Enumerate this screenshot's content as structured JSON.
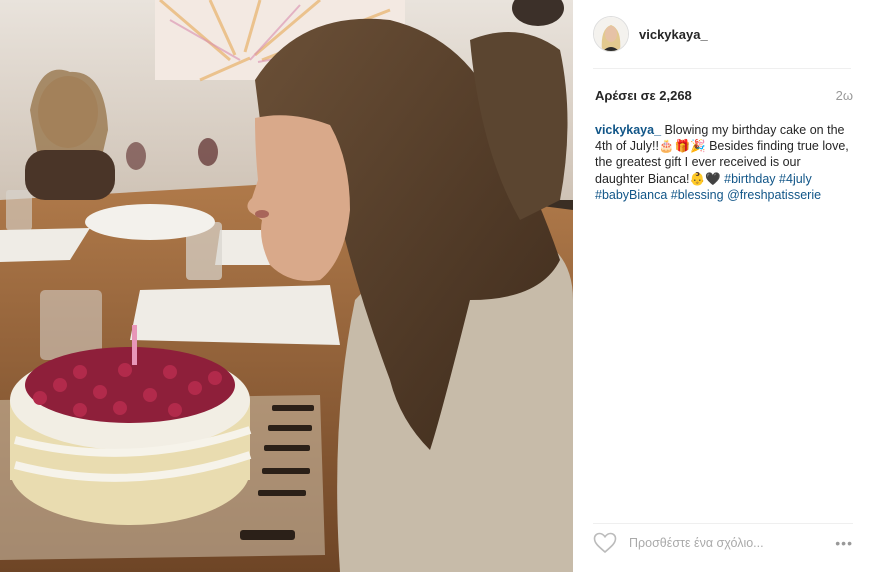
{
  "post": {
    "username": "vickykaya_",
    "likes_text": "Αρέσει σε 2,268",
    "time_ago": "2ω",
    "caption": {
      "user": "vickykaya_",
      "text": " Blowing my birthday cake on the 4th of July!!🎂🎁🎉 Besides finding true love, the greatest gift I ever received is our daughter Bianca!👶🖤 ",
      "hashtags": [
        "#birthday",
        "#4july",
        "#babyBianca",
        "#blessing"
      ],
      "mention": "@freshpatisserie"
    },
    "comment_placeholder": "Προσθέστε ένα σχόλιο...",
    "more_label": "•••"
  },
  "icons": {
    "like": "heart-icon",
    "more": "more-options-icon"
  },
  "colors": {
    "link": "#125688",
    "muted": "#999999",
    "text": "#262626"
  }
}
